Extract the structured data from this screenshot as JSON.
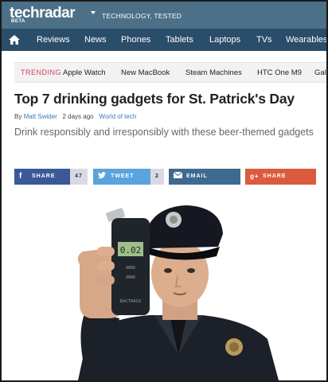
{
  "header": {
    "logo_text": "techradar",
    "beta_label": "BETA",
    "tagline": "TECHNOLOGY, TESTED",
    "brand_color": "#4c7088"
  },
  "nav": {
    "home_icon": "home-icon",
    "items": [
      "Reviews",
      "News",
      "Phones",
      "Tablets",
      "Laptops",
      "TVs",
      "Wearables"
    ]
  },
  "trending": {
    "label": "TRENDING",
    "items": [
      "Apple Watch",
      "New MacBook",
      "Steam Machines",
      "HTC One M9",
      "Gala"
    ]
  },
  "article": {
    "title": "Top 7 drinking gadgets for St. Patrick's Day",
    "by": "By",
    "author": "Matt Swider",
    "time": "2 days ago",
    "section": "World of tech",
    "subtitle": "Drink responsibly and irresponsibly with these beer-themed gadgets"
  },
  "share": {
    "facebook": {
      "label": "SHARE",
      "count": "47",
      "icon": "f",
      "color": "#3b5998"
    },
    "twitter": {
      "label": "TWEET",
      "count": "2",
      "icon": "t",
      "color": "#5aa3dc"
    },
    "email": {
      "label": "EMAIL",
      "icon": "envelope-icon",
      "color": "#3e6a8f"
    },
    "google": {
      "label": "SHARE",
      "icon": "g+",
      "color": "#dc5a3e"
    }
  },
  "image": {
    "breathalyzer_display": "0.02",
    "device_brand": "BACTRACK"
  }
}
